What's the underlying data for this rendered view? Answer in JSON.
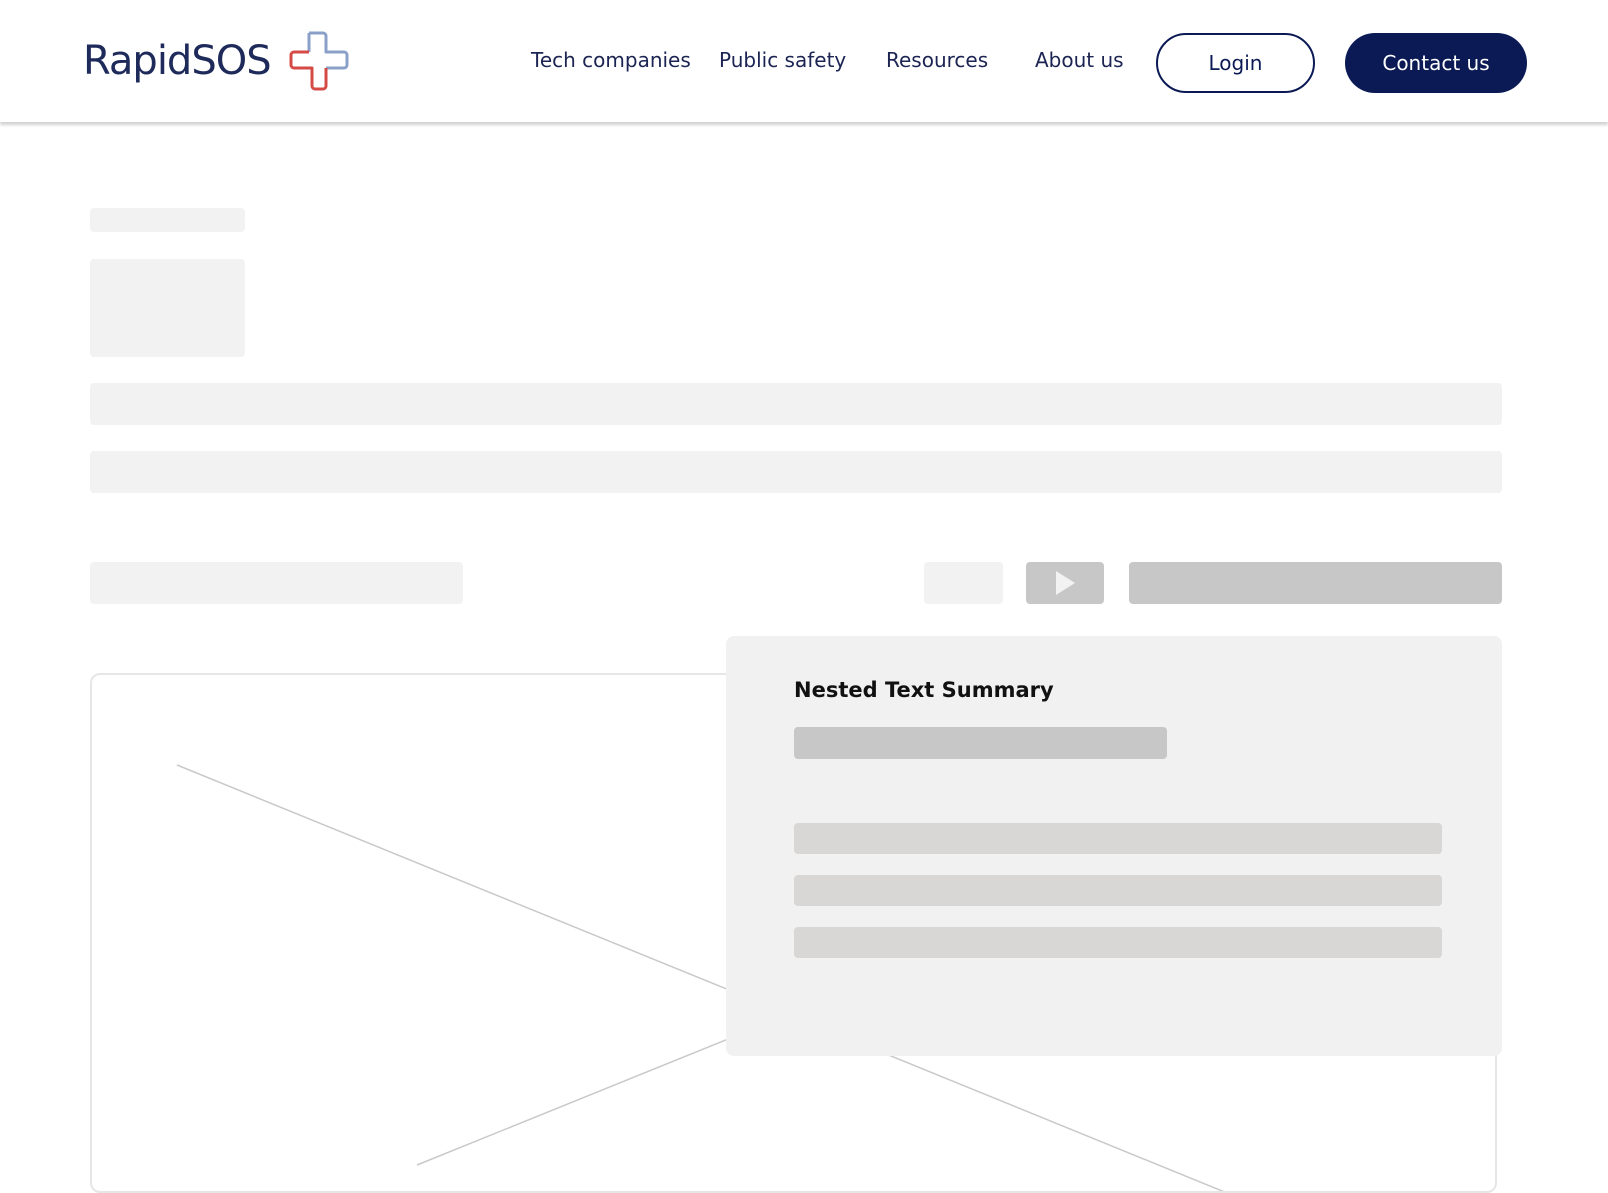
{
  "header": {
    "logo_text": "RapidSOS",
    "logo_mark_icon": "rapidsos-cross-icon",
    "nav": [
      {
        "label": "Tech companies"
      },
      {
        "label": "Public safety"
      },
      {
        "label": "Resources"
      },
      {
        "label": "About us"
      }
    ],
    "login_label": "Login",
    "contact_label": "Contact us"
  },
  "summary_card": {
    "title": "Nested Text Summary"
  },
  "icons": {
    "play": "play-icon"
  },
  "colors": {
    "brand_navy": "#0b1a55",
    "logo_red": "#d64a45",
    "logo_blue": "#8aa0c8",
    "placeholder_light": "#f2f2f2",
    "placeholder_dark": "#c6c7c6",
    "card_bg": "#f0f1f0"
  }
}
